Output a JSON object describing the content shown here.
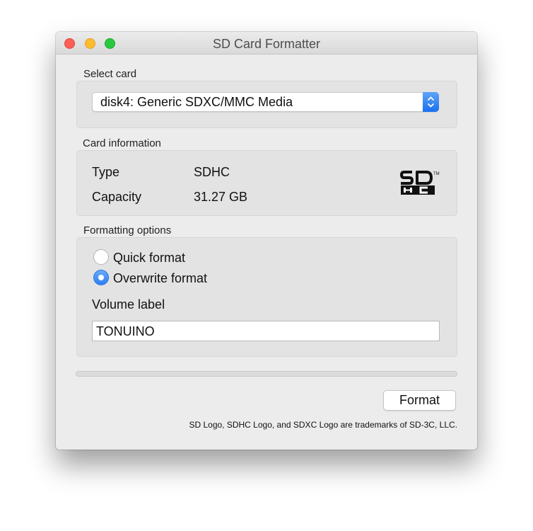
{
  "window": {
    "title": "SD Card Formatter"
  },
  "select_card": {
    "label": "Select card",
    "value": "disk4: Generic SDXC/MMC Media"
  },
  "card_info": {
    "label": "Card information",
    "type_label": "Type",
    "type_value": "SDHC",
    "capacity_label": "Capacity",
    "capacity_value": "31.27 GB",
    "logo_text": "SD HC",
    "logo_tm": "™"
  },
  "formatting": {
    "label": "Formatting options",
    "options": [
      {
        "label": "Quick format",
        "selected": false
      },
      {
        "label": "Overwrite format",
        "selected": true
      }
    ],
    "volume_label_title": "Volume label",
    "volume_label_value": "TONUINO"
  },
  "progress": {
    "value": 0
  },
  "actions": {
    "format_label": "Format"
  },
  "footer": {
    "text": "SD Logo, SDHC Logo, and SDXC Logo are trademarks of SD-3C, LLC."
  },
  "colors": {
    "accent": "#3a84f2",
    "close": "#fc5f57",
    "minimize": "#fdbc2e",
    "maximize": "#28c940"
  }
}
